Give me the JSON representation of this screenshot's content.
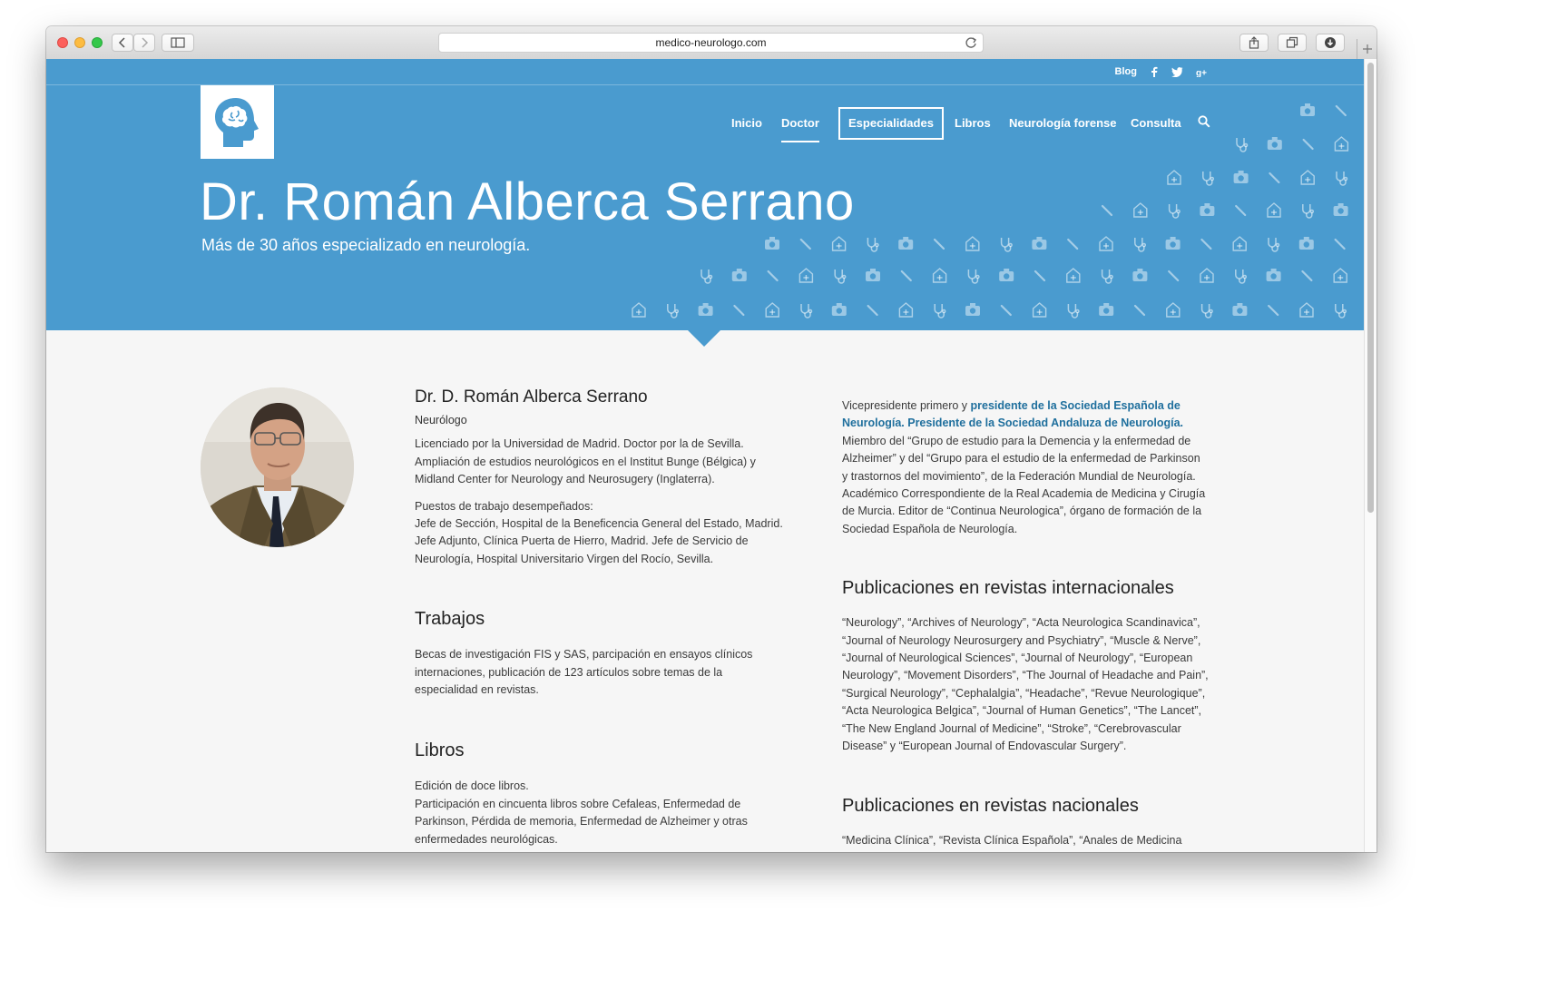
{
  "browser": {
    "url": "medico-neurologo.com",
    "icons": [
      "back-icon",
      "forward-icon",
      "sidebar-icon",
      "reload-icon",
      "share-icon",
      "tabs-icon",
      "download-icon",
      "plus-icon"
    ]
  },
  "site": {
    "top_links": {
      "blog": "Blog"
    },
    "social_icons": [
      "facebook-icon",
      "twitter-icon",
      "google-plus-icon"
    ],
    "nav": [
      {
        "label": "Inicio"
      },
      {
        "label": "Doctor",
        "active": true
      },
      {
        "label": "Especialidades",
        "boxed": true
      },
      {
        "label": "Libros"
      },
      {
        "label": "Neurología forense"
      },
      {
        "label": "Consulta"
      }
    ],
    "colors": {
      "hero": "#4a9bcf",
      "link": "#1f6f9d",
      "background": "#f6f6f6"
    }
  },
  "hero": {
    "title": "Dr. Román Alberca Serrano",
    "subtitle": "Más de 30 años especializado en neurología."
  },
  "profile": {
    "name": "Dr. D. Román Alberca Serrano",
    "role": "Neurólogo",
    "bio_lines": [
      "Licenciado  por la Universidad de Madrid. Doctor por la de Sevilla.",
      "Ampliación de estudios neurológicos en el Institut Bunge (Bélgica) y",
      "Midland Center for Neurology and Neurosugery (Inglaterra)."
    ],
    "jobs_title": "Puestos de trabajo desempeñados:",
    "jobs_lines": [
      "Jefe de Sección, Hospital de la Beneficencia General del Estado, Madrid.",
      "Jefe Adjunto, Clínica Puerta de Hierro, Madrid. Jefe de Servicio de",
      "Neurología, Hospital Universitario Virgen del Rocío, Sevilla."
    ]
  },
  "trabajos": {
    "heading": "Trabajos",
    "lines": [
      "Becas de investigación FIS y SAS, parcipación en ensayos clínicos",
      "internaciones, publicación de 123 artículos sobre temas de la",
      "especialidad en revistas."
    ]
  },
  "libros": {
    "heading": "Libros",
    "lines": [
      "Edición de doce libros.",
      "Participación en cincuenta libros sobre Cefaleas, Enfermedad de",
      "Parkinson, Pérdida de memoria, Enfermedad de Alzheimer y otras",
      "enfermedades neurológicas."
    ]
  },
  "honors": {
    "pre": "Vicepresidente primero y ",
    "link1_line1": "presidente de la Sociedad Española de",
    "link1_line2": "Neurología. Presidente de la Sociedad Andaluza de Neurología.",
    "lines": [
      "Miembro del “Grupo de estudio para la Demencia y la enfermedad de",
      "Alzheimer” y del  “Grupo para el estudio de la enfermedad de Parkinson",
      "y trastornos del movimiento”, de la Federación Mundial de Neurología.",
      "Académico Correspondiente de la Real Academia de Medicina  y Cirugía",
      "de Murcia. Editor de “Continua Neurologica”, órgano de formación de la",
      "Sociedad Española de Neurología."
    ]
  },
  "intl": {
    "heading": "Publicaciones en revistas internacionales",
    "lines": [
      "“Neurology”, “Archives of Neurology”, “Acta Neurologica Scandinavica”,",
      "“Journal of Neurology Neurosurgery and Psychiatry”, “Muscle & Nerve”,",
      "“Journal of Neurological Sciences”, “Journal of Neurology”, “European",
      "Neurology”,  “Movement Disorders”, “The Journal of Headache and Pain”,",
      "“Surgical Neurology”, “Cephalalgia”, “Headache”, “Revue Neurologique”,",
      "“Acta Neurologica Belgica”, “Journal of Human Genetics”, “The Lancet”,",
      "“The New England Journal of Medicine”, “Stroke”, “Cerebrovascular",
      "Disease” y “European Journal of Endovascular Surgery”."
    ]
  },
  "nacional": {
    "heading": "Publicaciones en revistas nacionales",
    "lines": [
      "“Medicina Clínica”, “Revista Clínica Española”, “Anales de Medicina"
    ]
  },
  "icon_names": {
    "pattern": [
      "camera-icon",
      "scalpel-icon",
      "medkit-icon",
      "stethoscope-icon"
    ],
    "logo": "brain-head-icon",
    "search": "search-icon"
  }
}
